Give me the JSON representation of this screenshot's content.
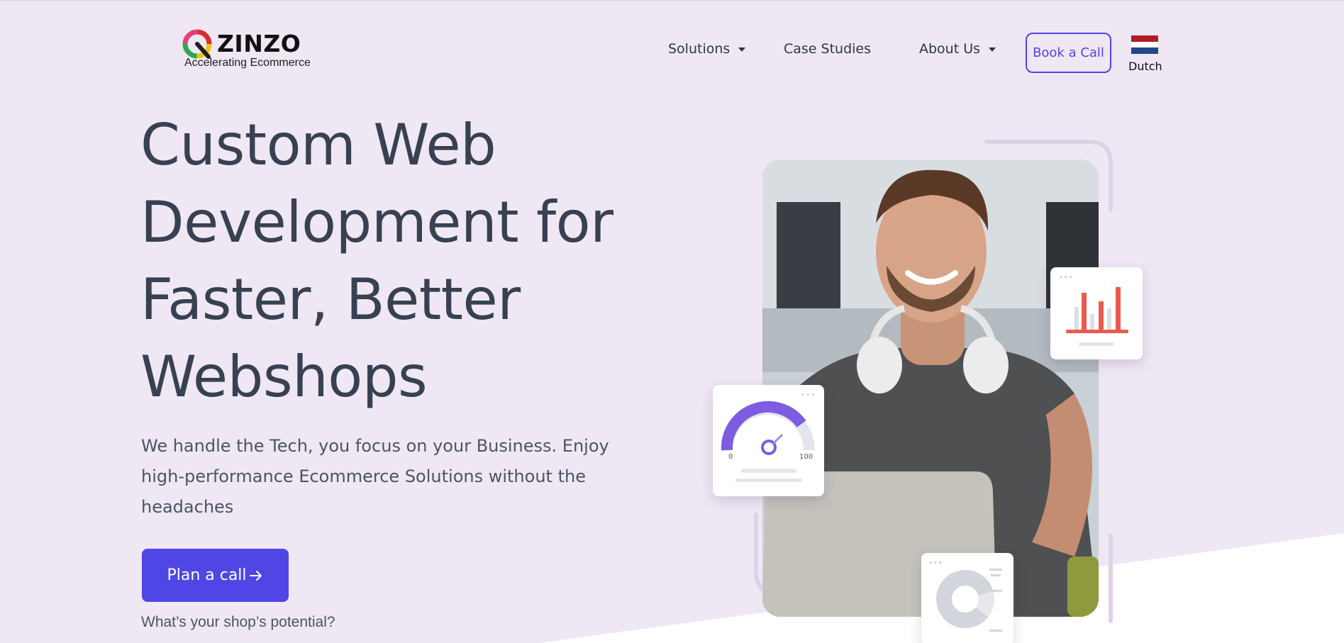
{
  "brand": {
    "name": "ZINZO",
    "tagline": "Accelerating Ecommerce"
  },
  "nav": {
    "items": [
      {
        "label": "Solutions",
        "dropdown": true
      },
      {
        "label": "Case Studies",
        "dropdown": false
      },
      {
        "label": "About Us",
        "dropdown": true
      }
    ],
    "cta_label": "Book a Call",
    "language_label": "Dutch",
    "flag_colors": [
      "#ae1c28",
      "#ffffff",
      "#21468b"
    ]
  },
  "hero": {
    "title_lines": [
      "Custom Web",
      "Development for",
      "Faster, Better",
      "Webshops"
    ],
    "subtitle": "We handle the Tech, you focus on your Business. Enjoy high-performance Ecommerce Solutions without the headaches",
    "cta_label": "Plan a call",
    "cta_icon": "arrow-right-icon",
    "footnote": "What’s your shop’s potential?"
  },
  "cards": {
    "gauge": {
      "min_label": "0",
      "max_label": "100"
    }
  },
  "colors": {
    "accent": "#4f46e5",
    "background": "#efe7f4",
    "heading": "#374151",
    "chart_bar": "#ea5a4f",
    "gauge_purple": "#7c5ce0"
  }
}
